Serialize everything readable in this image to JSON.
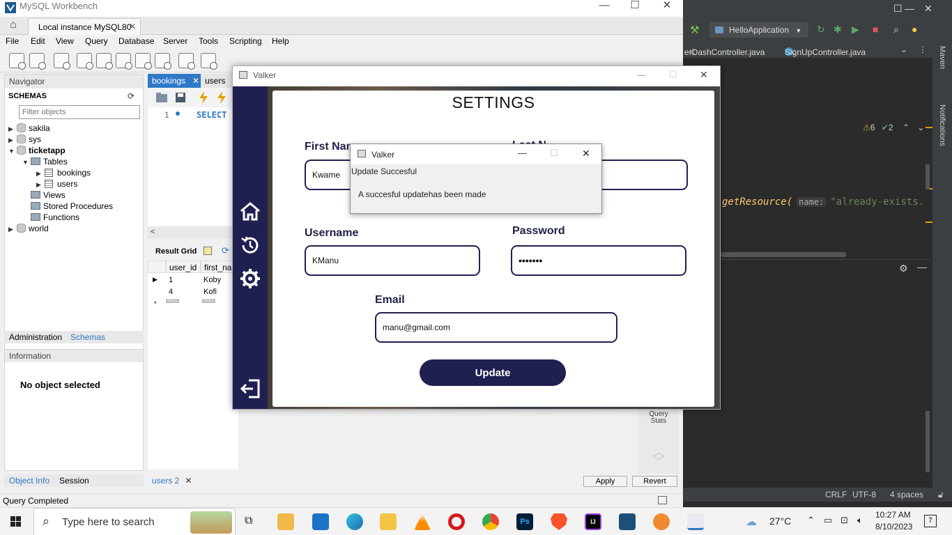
{
  "workbench": {
    "title": "MySQL Workbench",
    "conn_tab": "Local instance MySQL80",
    "menu": [
      "File",
      "Edit",
      "View",
      "Query",
      "Database",
      "Server",
      "Tools",
      "Scripting",
      "Help"
    ],
    "navigator": {
      "header": "Navigator",
      "schemas_label": "SCHEMAS",
      "filter_placeholder": "Filter objects",
      "tree": {
        "sakila": "sakila",
        "sys": "sys",
        "ticketapp": "ticketapp",
        "tables": "Tables",
        "bookings": "bookings",
        "users": "users",
        "views": "Views",
        "stored_procedures": "Stored Procedures",
        "functions": "Functions",
        "world": "world"
      },
      "tabs": [
        "Administration",
        "Schemas"
      ]
    },
    "information": {
      "header": "Information",
      "empty": "No object selected",
      "tabs": [
        "Object Info",
        "Session"
      ]
    },
    "editor": {
      "tabs": [
        "bookings",
        "users"
      ],
      "line_number": "1",
      "sql": "SELECT"
    },
    "result": {
      "label": "Result Grid",
      "columns": [
        "user_id",
        "first_na"
      ],
      "rows": [
        [
          "1",
          "Koby"
        ],
        [
          "4",
          "Kofi"
        ]
      ],
      "null_label": "NULL"
    },
    "query_stats": "Query Stats",
    "bottom_tab": "users 2",
    "apply_label": "Apply",
    "revert_label": "Revert",
    "status": "Query Completed"
  },
  "intellij": {
    "run_config": "HelloApplication",
    "file_tabs": [
      "erDashController.java",
      "SignUpController.java"
    ],
    "inspections": {
      "warnings": "6",
      "ok": "2"
    },
    "code": {
      "method": "getResource(",
      "param_hint": "name:",
      "string": "\"already-exists."
    },
    "side_labels": [
      "Maven",
      "Notifications"
    ],
    "status": {
      "line_sep": "CRLF",
      "encoding": "UTF-8",
      "indent": "4 spaces"
    }
  },
  "valker": {
    "window_title": "Valker",
    "heading": "SETTINGS",
    "labels": {
      "first_name": "First Nam",
      "last_name": "Last N",
      "username": "Username",
      "password": "Password",
      "email": "Email"
    },
    "values": {
      "first_name": "Kwame",
      "username": "KManu",
      "password": "•••••••",
      "email": "manu@gmail.com"
    },
    "update_label": "Update"
  },
  "dialog": {
    "title": "Valker",
    "header": "Update Succesful",
    "message": "A succesful updatehas been made"
  },
  "taskbar": {
    "search_placeholder": "Type here to search",
    "weather": "27°C",
    "time": "10:27 AM",
    "date": "8/10/2023",
    "notification_count": "7"
  },
  "colors": {
    "valker_navy": "#1f2050",
    "wb_accent": "#2e78c7",
    "ij_bg": "#2b2b2b"
  }
}
